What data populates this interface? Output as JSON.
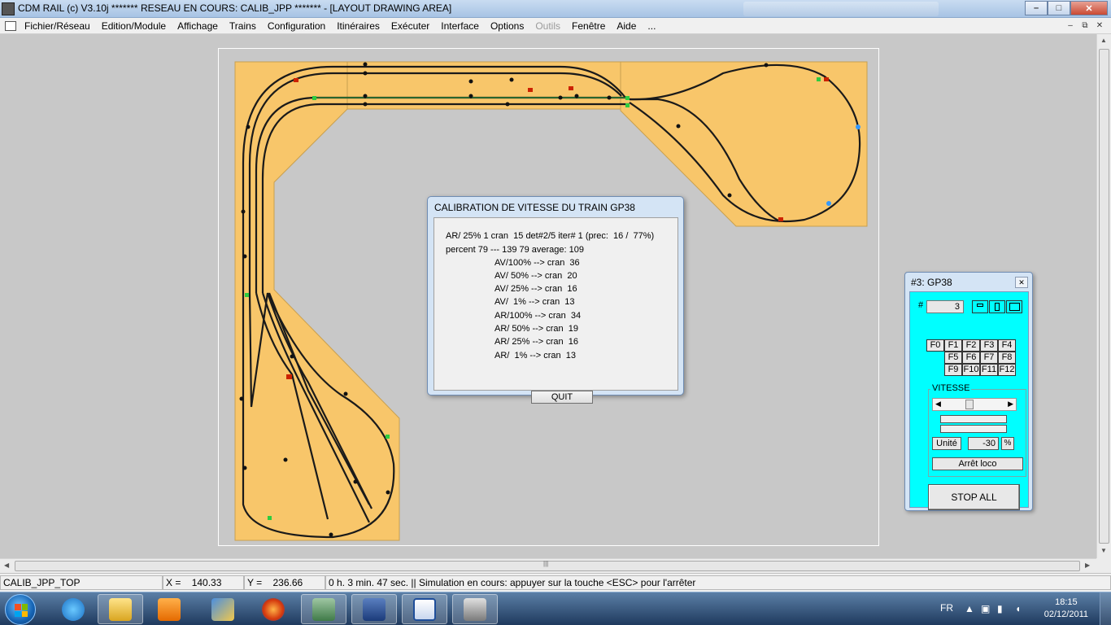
{
  "window": {
    "title": "CDM RAIL (c) V3.10j     ******* RESEAU EN COURS: CALIB_JPP ******* - [LAYOUT DRAWING AREA]",
    "minimize": "–",
    "maximize": "□",
    "close": "✕"
  },
  "menu": {
    "items": [
      "Fichier/Réseau",
      "Edition/Module",
      "Affichage",
      "Trains",
      "Configuration",
      "Itinéraires",
      "Exécuter",
      "Interface",
      "Options",
      "Outils",
      "Fenêtre",
      "Aide",
      "..."
    ],
    "disabled": [
      "Outils"
    ],
    "mdi_minimize": "–",
    "mdi_restore": "⧉",
    "mdi_close": "✕"
  },
  "calibration_dialog": {
    "title": "CALIBRATION DE VITESSE DU TRAIN GP38",
    "lines": [
      "AR/ 25% 1 cran  15 det#2/5 iter# 1 (prec:  16 /  77%)",
      "percent 79 --- 139 79 average: 109",
      "AV/100% --> cran  36",
      "AV/ 50% --> cran  20",
      "AV/ 25% --> cran  16",
      "AV/  1% --> cran  13",
      "AR/100% --> cran  34",
      "AR/ 50% --> cran  19",
      "AR/ 25% --> cran  16",
      "AR/  1% --> cran  13"
    ],
    "quit_label": "QUIT"
  },
  "loco_panel": {
    "title": "#3: GP38",
    "close": "✕",
    "number_label": "#",
    "number_value": "3",
    "function_keys": [
      "F0",
      "F1",
      "F2",
      "F3",
      "F4",
      "F5",
      "F6",
      "F7",
      "F8",
      "F9",
      "F10",
      "F11",
      "F12"
    ],
    "speed_legend": "VITESSE",
    "unit_label": "Unité",
    "speed_value": "-30",
    "percent_label": "%",
    "stop_loco_label": "Arrêt loco",
    "stop_all_label": "STOP ALL"
  },
  "status_bar": {
    "network": "CALIB_JPP_TOP",
    "x_label": "X =",
    "x_value": "140.33",
    "y_label": "Y =",
    "y_value": "236.66",
    "message": "0 h. 3 min. 47 sec.  || Simulation en cours: appuyer sur la touche <ESC> pour l'arrêter"
  },
  "taskbar": {
    "apps": [
      "windows-explorer",
      "internet-explorer",
      "media-player",
      "paint",
      "firefox",
      "remote-desktop",
      "dev-cpp",
      "word",
      "cdm-rail"
    ],
    "active_app": "cdm-rail",
    "language": "FR",
    "time": "18:15",
    "date": "02/12/2011"
  },
  "colors": {
    "layout_board": "#f8c66a",
    "track": "#1a1a1a",
    "canvas_bg": "#c8c8c8",
    "loco_panel_bg": "#00ffff"
  }
}
